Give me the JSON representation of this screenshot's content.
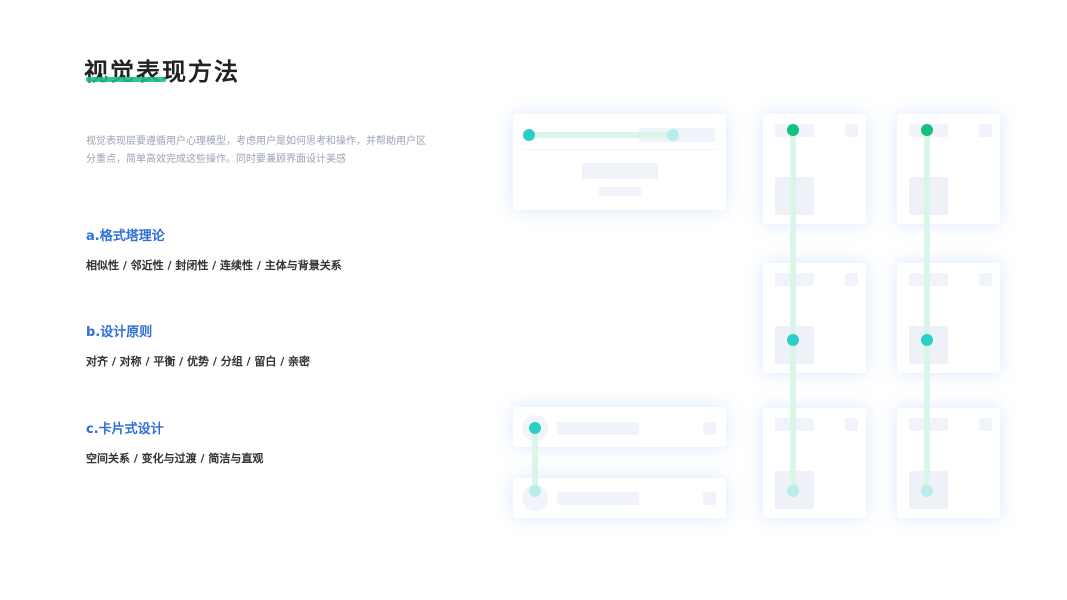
{
  "title": "视觉表现方法",
  "description_line1": "视觉表现层要遵循用户心理模型，考虑用户是如何思考和操作，并帮助用户区",
  "description_line2": "分重点，简单高效完成这些操作。同时要兼顾界面设计美感",
  "sections": [
    {
      "heading": "a.格式塔理论",
      "body": "相似性 / 邻近性 / 封闭性 / 连续性 / 主体与背景关系"
    },
    {
      "heading": "b.设计原则",
      "body": "对齐 / 对称 / 平衡 / 优势 / 分组 / 留白 / 亲密"
    },
    {
      "heading": "c.卡片式设计",
      "body": "空间关系 / 变化与过渡 / 简洁与直观"
    }
  ],
  "colors": {
    "accent_green": "#13c07f",
    "accent_teal": "#2ccfc5",
    "heading_blue": "#2f6fd8"
  }
}
